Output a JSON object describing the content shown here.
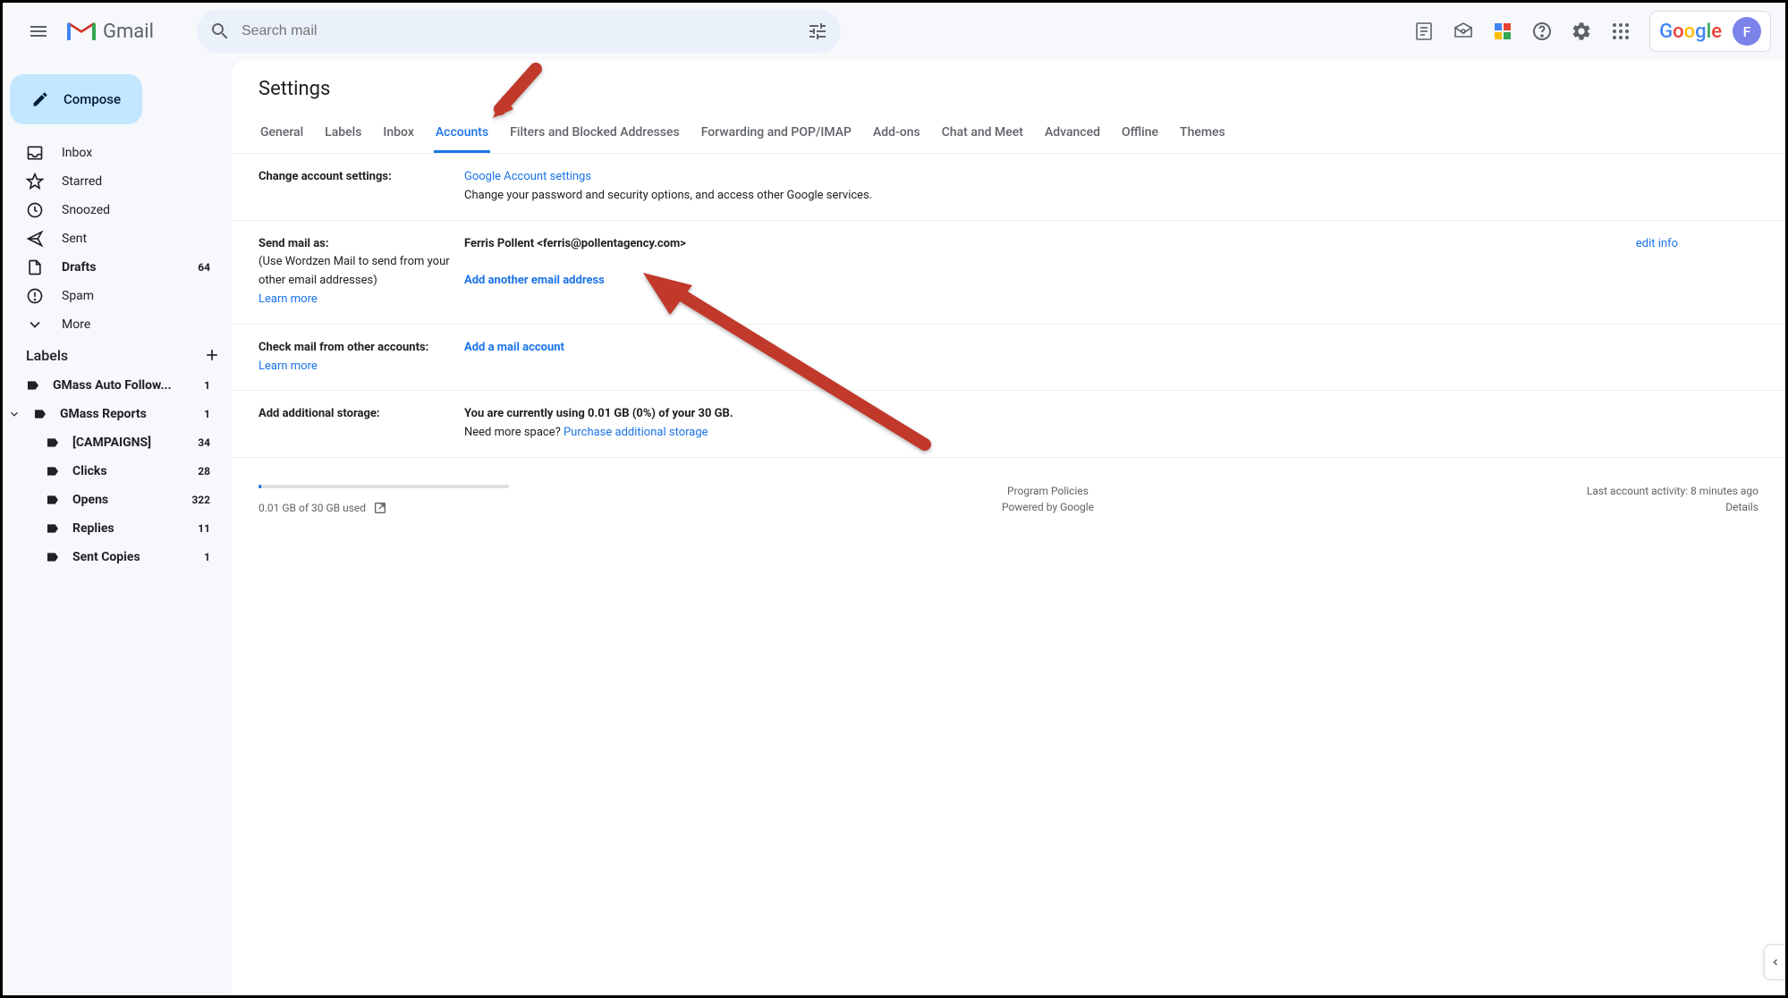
{
  "header": {
    "logo_text": "Gmail",
    "search_placeholder": "Search mail",
    "avatar_initial": "F"
  },
  "sidebar": {
    "compose": "Compose",
    "nav": [
      {
        "label": "Inbox",
        "count": ""
      },
      {
        "label": "Starred",
        "count": ""
      },
      {
        "label": "Snoozed",
        "count": ""
      },
      {
        "label": "Sent",
        "count": ""
      },
      {
        "label": "Drafts",
        "count": "64",
        "bold": true
      },
      {
        "label": "Spam",
        "count": ""
      },
      {
        "label": "More",
        "count": ""
      }
    ],
    "labels_header": "Labels",
    "labels": [
      {
        "label": "GMass Auto Follow...",
        "count": "1",
        "bold": true
      },
      {
        "label": "GMass Reports",
        "count": "1",
        "bold": true,
        "expandable": true
      },
      {
        "label": "[CAMPAIGNS]",
        "count": "34",
        "bold": true,
        "nested": true
      },
      {
        "label": "Clicks",
        "count": "28",
        "bold": true,
        "nested": true
      },
      {
        "label": "Opens",
        "count": "322",
        "bold": true,
        "nested": true
      },
      {
        "label": "Replies",
        "count": "11",
        "bold": true,
        "nested": true
      },
      {
        "label": "Sent Copies",
        "count": "1",
        "bold": true,
        "nested": true
      }
    ]
  },
  "main": {
    "title": "Settings",
    "tabs": [
      "General",
      "Labels",
      "Inbox",
      "Accounts",
      "Filters and Blocked Addresses",
      "Forwarding and POP/IMAP",
      "Add-ons",
      "Chat and Meet",
      "Advanced",
      "Offline",
      "Themes"
    ],
    "active_tab": "Accounts",
    "sections": {
      "change": {
        "label": "Change account settings:",
        "link": "Google Account settings",
        "desc": "Change your password and security options, and access other Google services."
      },
      "send": {
        "label": "Send mail as:",
        "sub": "(Use Wordzen Mail to send from your other email addresses)",
        "learn": "Learn more",
        "identity": "Ferris Pollent <ferris@pollentagency.com>",
        "add": "Add another email address",
        "edit": "edit info"
      },
      "check": {
        "label": "Check mail from other accounts:",
        "learn": "Learn more",
        "add": "Add a mail account"
      },
      "storage": {
        "label": "Add additional storage:",
        "status": "You are currently using 0.01 GB (0%) of your 30 GB.",
        "need": "Need more space? ",
        "purchase": "Purchase additional storage"
      }
    }
  },
  "footer": {
    "usage": "0.01 GB of 30 GB used",
    "policies": "Program Policies",
    "powered": "Powered by Google",
    "activity": "Last account activity: 8 minutes ago",
    "details": "Details"
  }
}
